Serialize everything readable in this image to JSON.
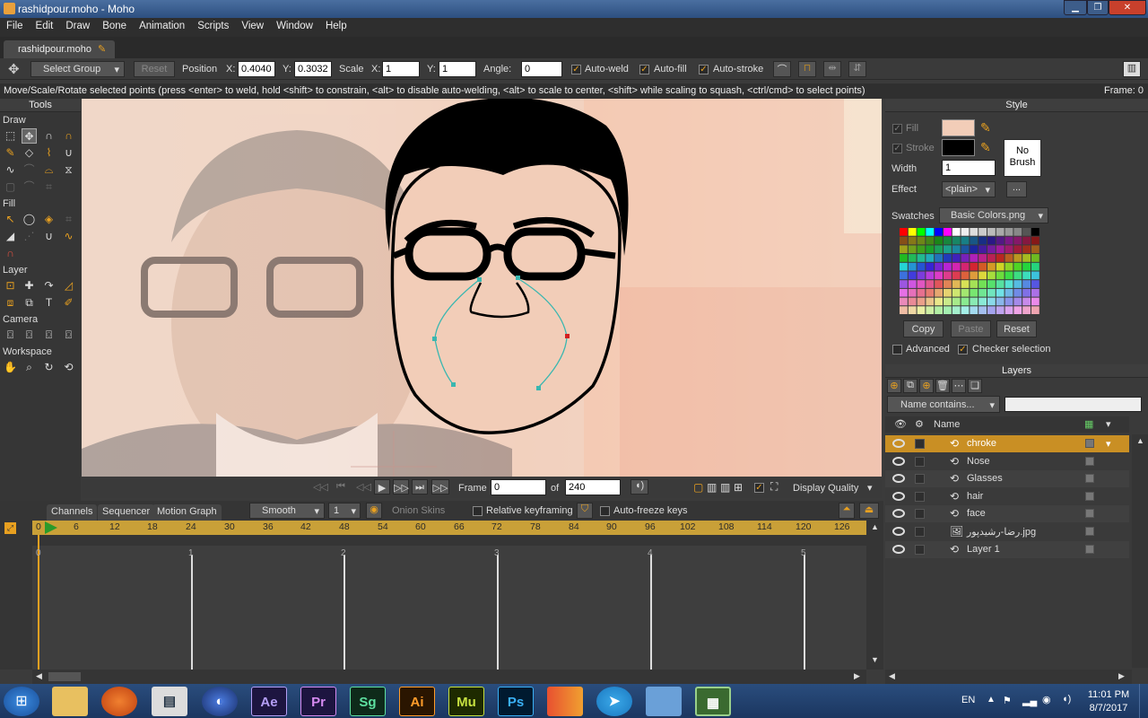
{
  "window": {
    "title": "rashidpour.moho - Moho"
  },
  "menu": [
    "File",
    "Edit",
    "Draw",
    "Bone",
    "Animation",
    "Scripts",
    "View",
    "Window",
    "Help"
  ],
  "doc_tab": "rashidpour.moho",
  "tooloptions": {
    "group_select": "Select Group",
    "reset": "Reset",
    "position_label": "Position",
    "x_label": "X:",
    "x_value": "0.4040",
    "y_label": "Y:",
    "y_value": "0.3032",
    "scale_label": "Scale",
    "sx_label": "X:",
    "sx_value": "1",
    "sy_label": "Y:",
    "sy_value": "1",
    "angle_label": "Angle:",
    "angle_value": "0",
    "autoweld": "Auto-weld",
    "autofill": "Auto-fill",
    "autostroke": "Auto-stroke"
  },
  "status": {
    "message": "Move/Scale/Rotate selected points (press <enter> to weld, hold <shift> to constrain, <alt> to disable auto-welding, <alt> to scale to center, <shift> while scaling to squash, <ctrl/cmd> to select points)",
    "frame": "Frame: 0"
  },
  "tools": {
    "title": "Tools",
    "draw": "Draw",
    "fill": "Fill",
    "layer": "Layer",
    "camera": "Camera",
    "workspace": "Workspace"
  },
  "playback": {
    "frame_label": "Frame",
    "frame_value": "0",
    "of_label": "of",
    "total": "240",
    "display_quality": "Display Quality"
  },
  "timeline": {
    "tabs": [
      "Channels",
      "Sequencer",
      "Motion Graph"
    ],
    "interp": "Smooth",
    "interp_num": "1",
    "onion": "Onion Skins",
    "relative": "Relative keyframing",
    "autofreeze": "Auto-freeze keys",
    "ruler": [
      "0",
      "6",
      "12",
      "18",
      "24",
      "30",
      "36",
      "42",
      "48",
      "54",
      "60",
      "66",
      "72",
      "78",
      "84",
      "90",
      "96",
      "102",
      "108",
      "114",
      "120",
      "126"
    ],
    "seconds": [
      "0",
      "1",
      "2",
      "3",
      "4",
      "5"
    ]
  },
  "style": {
    "title": "Style",
    "fill": "Fill",
    "stroke": "Stroke",
    "fill_color": "#f2cdb8",
    "stroke_color": "#000000",
    "no_brush": [
      "No",
      "Brush"
    ],
    "width_label": "Width",
    "width_value": "1",
    "effect_label": "Effect",
    "effect_value": "<plain>",
    "effect_more": "...",
    "swatches_label": "Swatches",
    "swatches_value": "Basic Colors.png",
    "copy": "Copy",
    "paste": "Paste",
    "reset": "Reset",
    "advanced": "Advanced",
    "checker": "Checker selection"
  },
  "layers": {
    "title": "Layers",
    "filter": "Name contains...",
    "name_header": "Name",
    "rows": [
      {
        "name": "chroke",
        "icon": "vector-layer-icon",
        "selected": true
      },
      {
        "name": "Nose",
        "icon": "vector-layer-icon",
        "selected": false
      },
      {
        "name": "Glasses",
        "icon": "vector-layer-icon",
        "selected": false
      },
      {
        "name": "hair",
        "icon": "vector-layer-icon",
        "selected": false
      },
      {
        "name": "face",
        "icon": "vector-layer-icon",
        "selected": false
      },
      {
        "name": "رضا-رشیدپور.jpg",
        "icon": "image-layer-icon",
        "selected": false
      },
      {
        "name": "Layer 1",
        "icon": "vector-layer-icon",
        "selected": false
      }
    ]
  },
  "taskbar": {
    "apps": [
      "Ae",
      "Pr",
      "Sg",
      "Ai",
      "Mu",
      "Ps"
    ],
    "lang": "EN",
    "time": "11:01 PM",
    "date": "8/7/2017"
  }
}
